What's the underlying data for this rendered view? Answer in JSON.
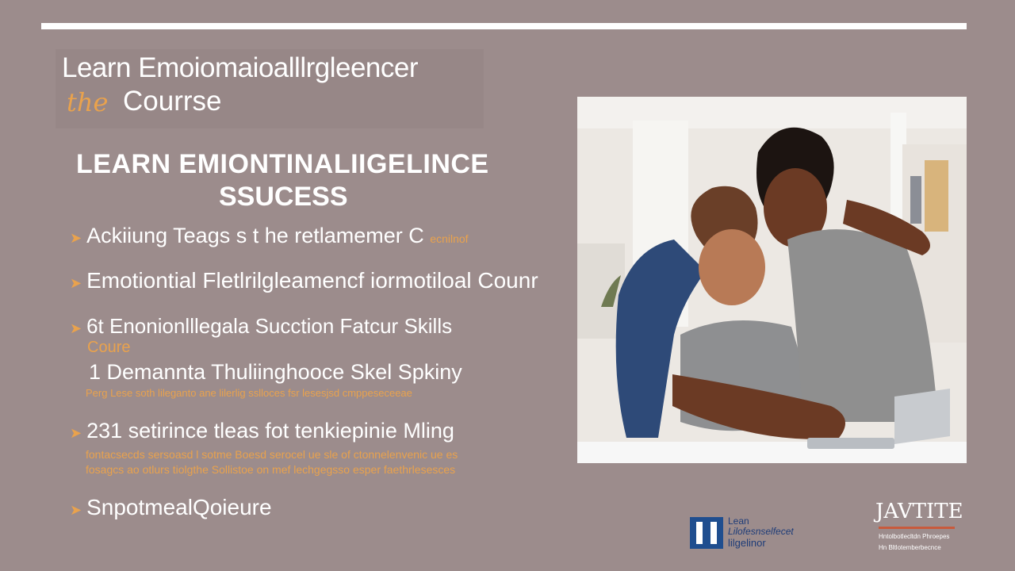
{
  "header": {
    "title_line1": "Learn Emoiomaioalllrgleencer",
    "title_line2_script": "the",
    "title_line2": "Courrse"
  },
  "subtitle": {
    "line1": "LEARN  EMIONTINALIIGELINCE",
    "line2": "SSUCESS"
  },
  "bullets": {
    "b1_main": "Ackiiung Teags s t he retlamemer C",
    "b1_small": "ecnilnof",
    "b2": "Emotiontial Fletlrilgleamencf iormotiloal Counr",
    "b3_main": "6t Enonionlllegala Sucction Fatcur Skills",
    "b3_cont": "Coure",
    "b4_main": "1 Demannta Thuliinghooce Skel Spkiny",
    "b4_small": "Perg Lese soth lileganto ane lilerlig sslloces fsr lesesjsd cmppeseceeae",
    "b5_main": "231  setirince tleas  fot tenkiepinie Mling",
    "b5_small1": "fontacsecds sersoasd l sotme Boesd serocel ue sle of ctonnelenvenic ue es",
    "b5_small2": "fosagcs ao otlurs tiolgthe Sollistoe on mef lechgegsso esper faethrlesesces",
    "b6": "SnpotmealQoieure"
  },
  "icons": {
    "arrow": "arrow-bullet-icon",
    "accent_color": "#e9a24d"
  },
  "logos": {
    "left_l1": "Lean",
    "left_l2": "Lilofesnselfecet",
    "left_l3": "lilgelinor",
    "right_title": "JAVTITE",
    "right_s1": "Hntolbotlecltdn Phroepes",
    "right_s2": "Hn Bltlotemberbecnce"
  }
}
